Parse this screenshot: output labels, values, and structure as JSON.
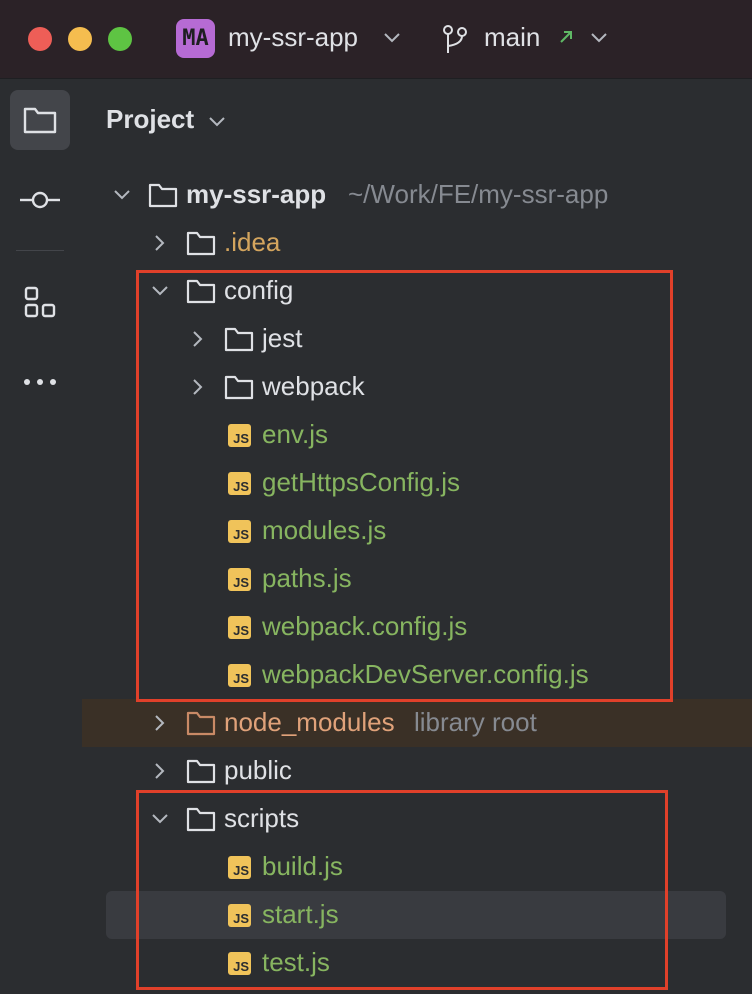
{
  "titlebar": {
    "project_initials": "MA",
    "project_name": "my-ssr-app",
    "branch_name": "main",
    "colors": {
      "close": "#ee5e57",
      "minimize": "#f5bd4f",
      "zoom": "#5ec443",
      "badge": "#b66bd4"
    }
  },
  "sidebar": {
    "items": [
      {
        "name": "project-tool",
        "icon": "folder-icon",
        "active": true
      },
      {
        "name": "commit-tool",
        "icon": "commit-icon",
        "active": false
      },
      {
        "name": "structure-tool",
        "icon": "structure-icon",
        "active": false
      },
      {
        "name": "more-tools",
        "icon": "more-icon",
        "active": false
      }
    ]
  },
  "panel": {
    "title": "Project"
  },
  "tree": {
    "root": {
      "label": "my-ssr-app",
      "path": "~/Work/FE/my-ssr-app"
    },
    "idea": ".idea",
    "config": {
      "label": "config",
      "children": [
        "jest",
        "webpack"
      ],
      "files": [
        "env.js",
        "getHttpsConfig.js",
        "modules.js",
        "paths.js",
        "webpack.config.js",
        "webpackDevServer.config.js"
      ]
    },
    "node_modules": {
      "label": "node_modules",
      "note": "library root"
    },
    "public": "public",
    "scripts": {
      "label": "scripts",
      "files": [
        "build.js",
        "start.js",
        "test.js"
      ]
    },
    "js_badge": "JS"
  }
}
